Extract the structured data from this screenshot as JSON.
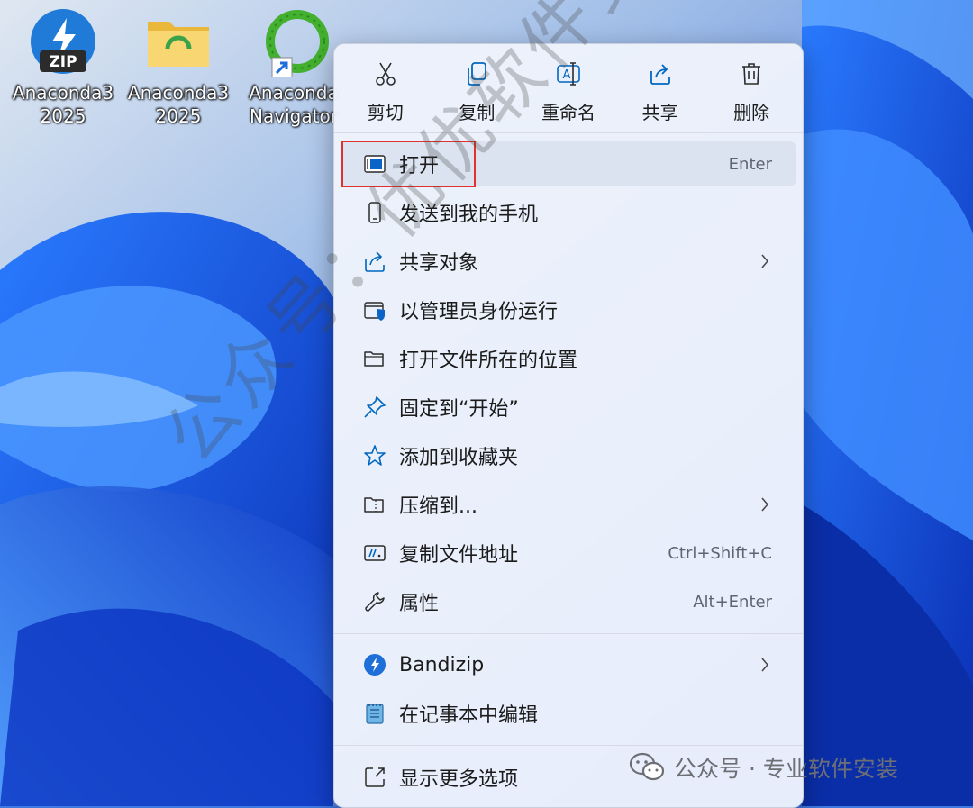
{
  "desktop": {
    "icons": [
      {
        "caption": "Anaconda3\n2025",
        "icon": "bandizip-zip-icon"
      },
      {
        "caption": "Anaconda3\n2025",
        "icon": "folder-icon"
      },
      {
        "caption": "Anaconda\nNavigator",
        "icon": "anaconda-navigator-icon"
      }
    ]
  },
  "menu": {
    "toolbar": [
      {
        "label": "剪切",
        "icon": "scissors-icon"
      },
      {
        "label": "复制",
        "icon": "copy-icon"
      },
      {
        "label": "重命名",
        "icon": "rename-icon"
      },
      {
        "label": "共享",
        "icon": "share-icon"
      },
      {
        "label": "删除",
        "icon": "trash-icon"
      }
    ],
    "items": [
      {
        "label": "打开",
        "shortcut": "Enter",
        "icon": "open-app-icon",
        "highlighted": true
      },
      {
        "label": "发送到我的手机",
        "shortcut": "",
        "icon": "phone-icon"
      },
      {
        "label": "共享对象",
        "shortcut": "",
        "icon": "share-icon",
        "submenu": true
      },
      {
        "label": "以管理员身份运行",
        "shortcut": "",
        "icon": "shield-icon"
      },
      {
        "label": "打开文件所在的位置",
        "shortcut": "",
        "icon": "folder-open-icon"
      },
      {
        "label": "固定到“开始”",
        "shortcut": "",
        "icon": "pin-icon"
      },
      {
        "label": "添加到收藏夹",
        "shortcut": "",
        "icon": "star-icon"
      },
      {
        "label": "压缩到...",
        "shortcut": "",
        "icon": "zip-folder-icon",
        "submenu": true
      },
      {
        "label": "复制文件地址",
        "shortcut": "Ctrl+Shift+C",
        "icon": "copy-path-icon"
      },
      {
        "label": "属性",
        "shortcut": "Alt+Enter",
        "icon": "wrench-icon"
      },
      {
        "label": "Bandizip",
        "shortcut": "",
        "icon": "bandizip-icon",
        "submenu": true
      },
      {
        "label": "在记事本中编辑",
        "shortcut": "",
        "icon": "notepad-icon"
      },
      {
        "label": "显示更多选项",
        "shortcut": "",
        "icon": "show-more-icon"
      }
    ]
  },
  "watermark": {
    "diagonal": "公众号：优优软件安装",
    "brand": "公众号 · 专业软件安装"
  },
  "colors": {
    "accent": "#0067c0",
    "highlight_box": "#e0312b"
  }
}
